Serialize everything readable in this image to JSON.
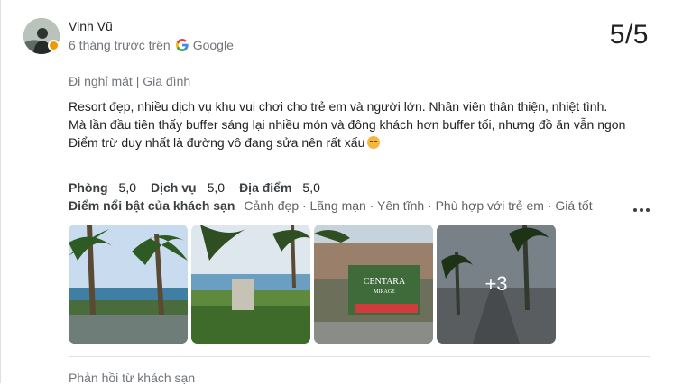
{
  "review": {
    "author": "Vinh Vũ",
    "time_ago": "6 tháng trước trên",
    "source": "Google",
    "rating": "5/5",
    "trip_type": "Đi nghỉ mát | Gia đình",
    "text_lines": [
      "Resort đẹp, nhiều dịch vụ khu vui chơi cho trẻ em và người lớn. Nhân viên thân thiện, nhiệt tình.",
      "Mà lần đầu tiên thấy buffer sáng lại nhiều món và đông khách hơn buffer tối, nhưng đồ ăn vẫn ngon",
      "Điểm trừ duy nhất là đường vô đang sửa nên rất xấu"
    ],
    "emoji": "unamused-face",
    "ratings": [
      {
        "label": "Phòng",
        "value": "5,0"
      },
      {
        "label": "Dịch vụ",
        "value": "5,0"
      },
      {
        "label": "Địa điểm",
        "value": "5,0"
      }
    ],
    "highlights_label": "Điểm nổi bật của khách sạn",
    "highlights": "Cảnh đẹp · Lãng mạn · Yên tĩnh · Phù hợp với trẻ em · Giá tốt",
    "more_photos": "+3",
    "photos": [
      "palm-pool-view",
      "sea-garden-view",
      "centara-mirage-sign",
      "street-palm-view"
    ],
    "owner_reply_label": "Phản hồi từ khách sạn"
  },
  "colors": {
    "text": "#202124",
    "muted": "#70757a",
    "accent_badge": "#f29900"
  }
}
